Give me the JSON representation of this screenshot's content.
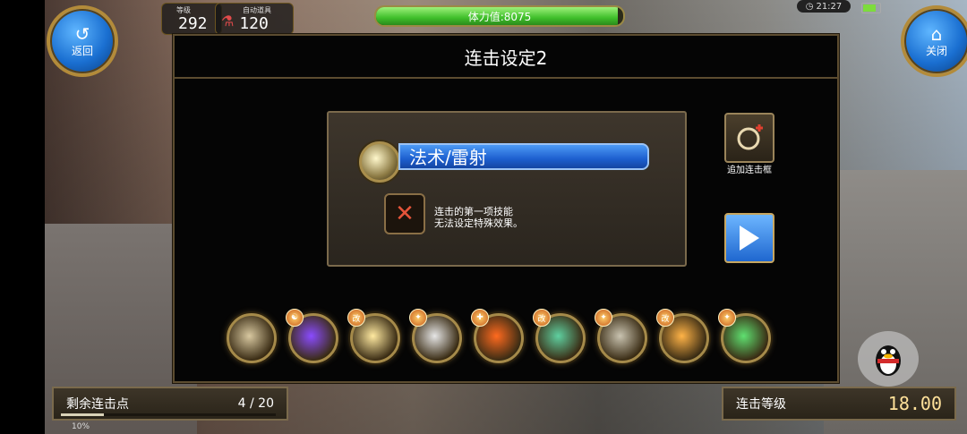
{
  "top_bar": {
    "back_label": "返回",
    "close_label": "关闭",
    "level_label": "等级",
    "level_value": "292",
    "auto_item_label": "自动道具",
    "auto_item_value": "120",
    "stamina_text": "体力值:8075",
    "stamina_fill": 0.98,
    "clock_time": "21:27"
  },
  "dialog": {
    "title": "连击设定2",
    "skill_name": "法术/雷射",
    "warning_line1": "连击的第一项技能",
    "warning_line2": "无法设定特殊效果。",
    "add_frame_label": "追加连击框"
  },
  "skills": [
    {
      "name": "skill-1",
      "color": "#d8c8a0",
      "badge": ""
    },
    {
      "name": "skill-2",
      "color": "#8a4bff",
      "badge": "☯"
    },
    {
      "name": "skill-3",
      "color": "#ffe9a0",
      "badge": "改"
    },
    {
      "name": "skill-4",
      "color": "#e6e6e6",
      "badge": "✦"
    },
    {
      "name": "skill-5",
      "color": "#ff6a1f",
      "badge": "✚"
    },
    {
      "name": "skill-6",
      "color": "#5fd0a0",
      "badge": "改"
    },
    {
      "name": "skill-7",
      "color": "#c9c3b0",
      "badge": "✦"
    },
    {
      "name": "skill-8",
      "color": "#ffb347",
      "badge": "改"
    },
    {
      "name": "skill-9",
      "color": "#5fe070",
      "badge": "✦"
    }
  ],
  "bottom": {
    "remaining_label": "剩余连击点",
    "remaining_value": "4 / 20",
    "remaining_fraction": 0.2,
    "combo_level_label": "连击等级",
    "combo_level_value": "18.00",
    "exp_text": "10%"
  }
}
